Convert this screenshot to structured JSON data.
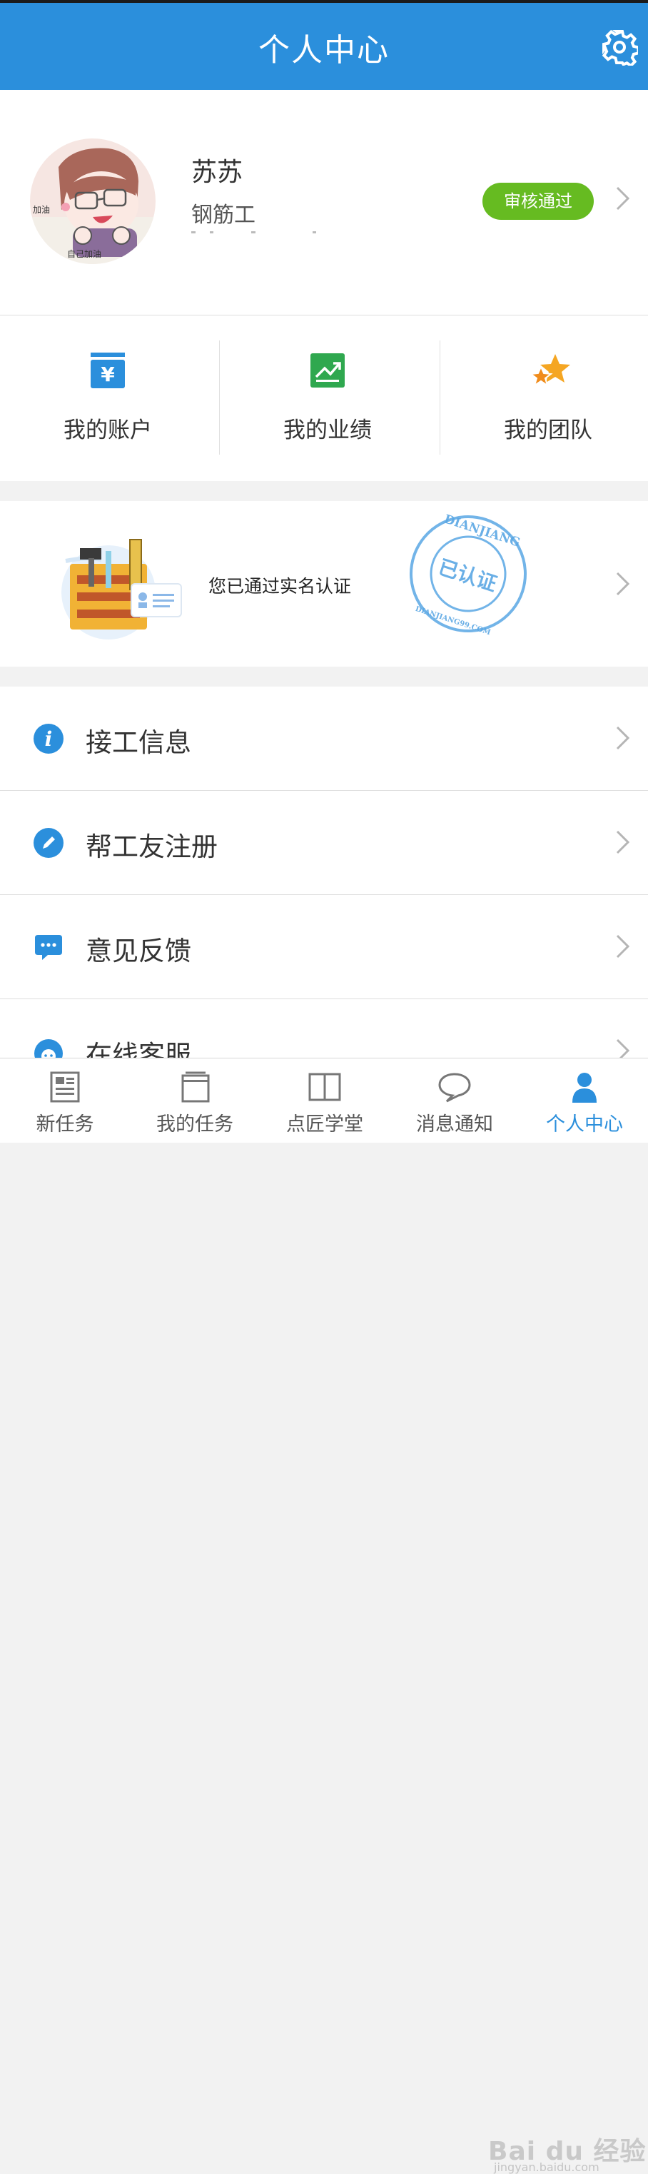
{
  "header": {
    "title": "个人中心",
    "settings_icon": "gear-icon"
  },
  "profile": {
    "name": "苏苏",
    "role": "钢筋工",
    "status_badge": "审核通过",
    "status_color": "#66bb21"
  },
  "quick_menu": [
    {
      "label": "我的账户",
      "icon": "wallet-icon"
    },
    {
      "label": "我的业绩",
      "icon": "chart-icon"
    },
    {
      "label": "我的团队",
      "icon": "stars-icon"
    }
  ],
  "verification": {
    "text": "您已通过实名认证",
    "stamp_top": "DIANJIANG",
    "stamp_center": "已认证",
    "stamp_bottom": "DIANJIANG99.COM"
  },
  "menu_items": [
    {
      "label": "接工信息",
      "icon": "info-icon"
    },
    {
      "label": "帮工友注册",
      "icon": "edit-icon"
    },
    {
      "label": "意见反馈",
      "icon": "chat-icon"
    },
    {
      "label": "在线客服",
      "icon": "support-icon"
    }
  ],
  "bottom_nav": [
    {
      "label": "新任务",
      "icon": "news-icon"
    },
    {
      "label": "我的任务",
      "icon": "tasks-icon"
    },
    {
      "label": "点匠学堂",
      "icon": "book-icon"
    },
    {
      "label": "消息通知",
      "icon": "message-icon"
    },
    {
      "label": "个人中心",
      "icon": "person-icon",
      "active": true
    }
  ],
  "colors": {
    "primary": "#2b8fdc",
    "success": "#66bb21"
  },
  "watermark": {
    "text": "Bai du 经验",
    "sub": "jingyan.baidu.com"
  }
}
